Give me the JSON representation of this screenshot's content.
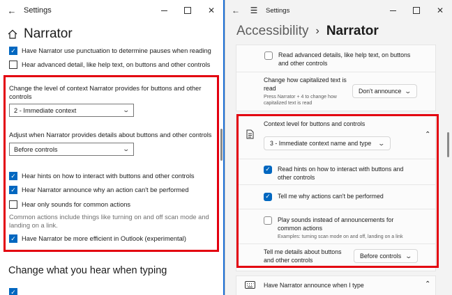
{
  "left_window": {
    "title": "Settings",
    "page_title": "Narrator",
    "items": {
      "punctuation": {
        "label": "Have Narrator use punctuation to determine pauses when reading",
        "checked": true
      },
      "advanced_detail": {
        "label": "Hear advanced detail, like help text, on buttons and other controls",
        "checked": false
      },
      "context_label": "Change the level of context Narrator provides for buttons and other controls",
      "context_value": "2 - Immediate context",
      "details_label": "Adjust when Narrator provides details about buttons and other controls",
      "details_value": "Before controls",
      "hints": {
        "label": "Hear hints on how to interact with buttons and other controls",
        "checked": true
      },
      "why_action": {
        "label": "Hear Narrator announce why an action can't be performed",
        "checked": true
      },
      "only_sounds": {
        "label": "Hear only sounds for common actions",
        "checked": false
      },
      "common_desc": "Common actions include things like turning on and off scan mode and landing on a link.",
      "outlook": {
        "label": "Have Narrator be more efficient in Outlook (experimental)",
        "checked": true
      }
    },
    "section_title": "Change what you hear when typing"
  },
  "right_window": {
    "title": "Settings",
    "breadcrumb": {
      "parent": "Accessibility",
      "sep": "›",
      "current": "Narrator"
    },
    "advanced": {
      "label": "Read advanced details, like help text, on buttons and other controls",
      "checked": false
    },
    "capitalized": {
      "label": "Change how capitalized text is read",
      "hint": "Press Narrator + 4 to change how capitalized text is read",
      "value": "Don't announce"
    },
    "context_card": {
      "title": "Context level for buttons and controls",
      "value": "3 - Immediate context name and type"
    },
    "hints": {
      "label": "Read hints on how to interact with buttons and other controls",
      "checked": true
    },
    "why": {
      "label": "Tell me why actions can't be performed",
      "checked": true
    },
    "sounds": {
      "label": "Play sounds instead of announcements for common actions",
      "example": "Examples: turning scan mode on and off, landing on a link",
      "checked": false
    },
    "details": {
      "label": "Tell me details about buttons and other controls",
      "value": "Before controls"
    },
    "typing": {
      "label": "Have Narrator announce when I type"
    }
  },
  "colors": {
    "accent": "#0067c0",
    "highlight": "#e3000f",
    "desktop": "#1a6fd6"
  }
}
